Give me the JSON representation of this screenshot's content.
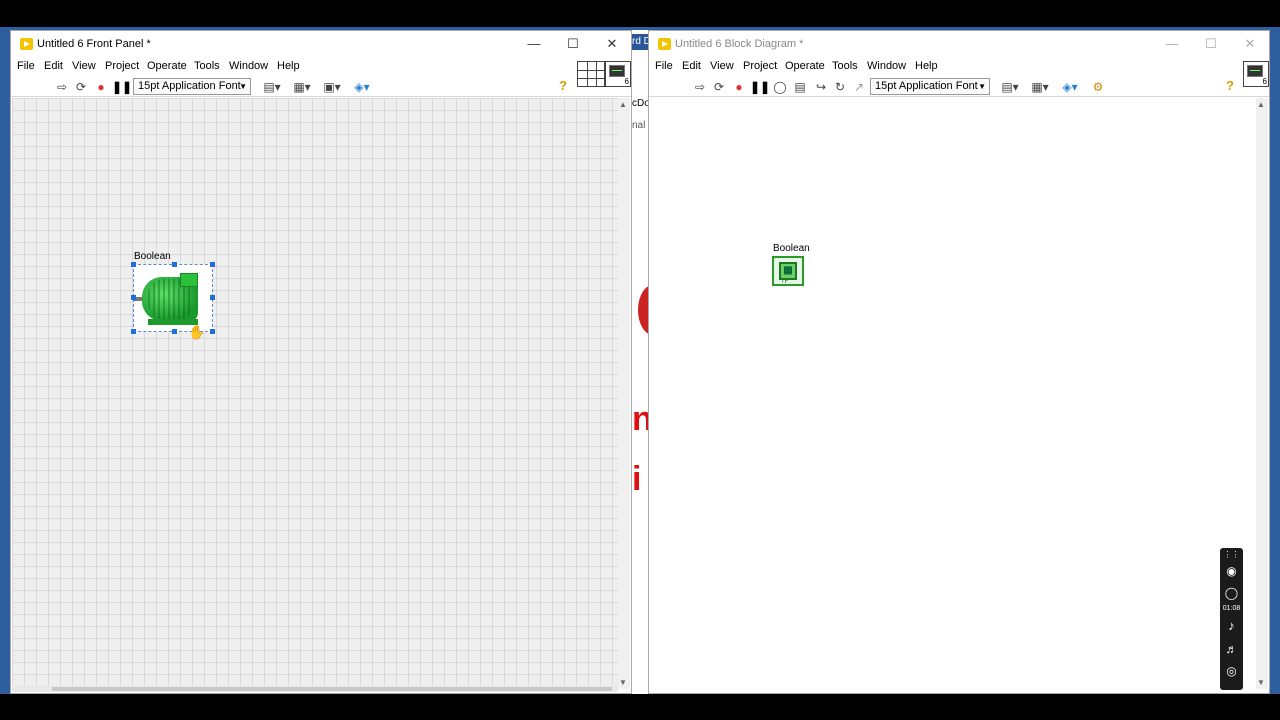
{
  "background_window": {
    "title_fragment": "rd D",
    "text_fragment_1": "cDo",
    "text_fragment_2": "nal",
    "red_fragment_1": "ns",
    "red_fragment_2": "i"
  },
  "front_panel": {
    "title": "Untitled 6 Front Panel *",
    "menu": [
      "File",
      "Edit",
      "View",
      "Project",
      "Operate",
      "Tools",
      "Window",
      "Help"
    ],
    "font_select": "15pt Application Font",
    "vi_icon_number": "6",
    "control_label": "Boolean"
  },
  "block_diagram": {
    "title": "Untitled 6 Block Diagram *",
    "menu": [
      "File",
      "Edit",
      "View",
      "Project",
      "Operate",
      "Tools",
      "Window",
      "Help"
    ],
    "font_select": "15pt Application Font",
    "vi_icon_number": "6",
    "terminal_label": "Boolean",
    "terminal_type": "TF"
  },
  "recorder": {
    "time": "01:08"
  },
  "icons": {
    "run": "run-arrow-icon",
    "run_continuous": "run-continuously-icon",
    "abort": "abort-icon",
    "pause": "pause-icon",
    "highlight": "highlight-execution-icon",
    "help": "help-icon"
  }
}
